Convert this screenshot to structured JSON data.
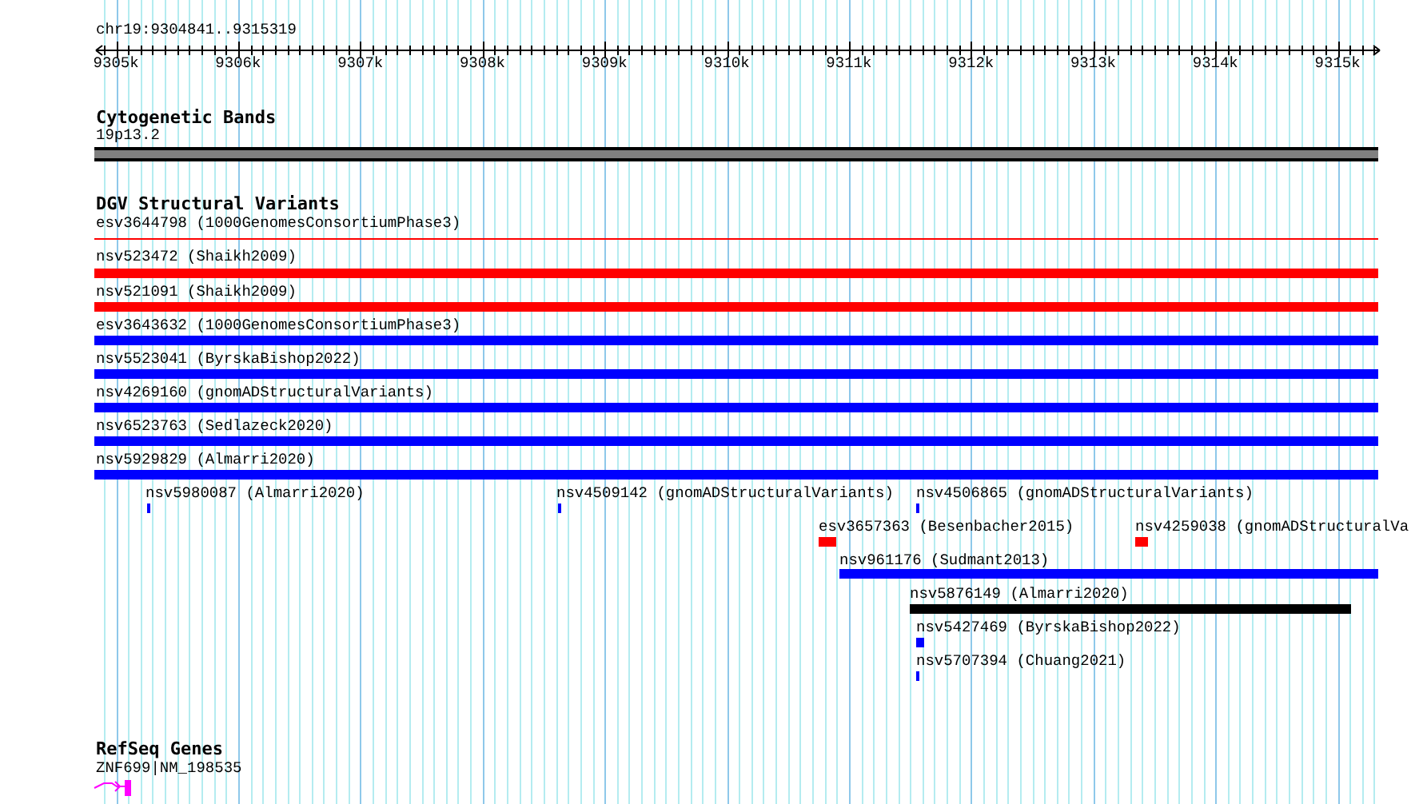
{
  "ruler": {
    "region": "chr19:9304841..9315319",
    "ticks": [
      "9305k",
      "9306k",
      "9307k",
      "9308k",
      "9309k",
      "9310k",
      "9311k",
      "9312k",
      "9313k",
      "9314k",
      "9315k"
    ]
  },
  "tracks": [
    {
      "title": "Cytogenetic Bands",
      "kind": "cytoband",
      "features": [
        {
          "label": "19p13.2",
          "color": "#808080"
        }
      ]
    },
    {
      "title": "DGV Structural Variants",
      "kind": "variants",
      "features": [
        {
          "label": "esv3644798 (1000GenomesConsortiumPhase3)",
          "kind": "line",
          "color": "#ff0000"
        },
        {
          "label": "nsv523472 (Shaikh2009)",
          "kind": "bar",
          "color": "#ff0000"
        },
        {
          "label": "nsv521091 (Shaikh2009)",
          "kind": "bar",
          "color": "#ff0000"
        },
        {
          "label": "esv3643632 (1000GenomesConsortiumPhase3)",
          "kind": "bar",
          "color": "#0000ff"
        },
        {
          "label": "nsv5523041 (ByrskaBishop2022)",
          "kind": "bar",
          "color": "#0000ff"
        },
        {
          "label": "nsv4269160 (gnomADStructuralVariants)",
          "kind": "bar",
          "color": "#0000ff"
        },
        {
          "label": "nsv6523763 (Sedlazeck2020)",
          "kind": "bar",
          "color": "#0000ff"
        },
        {
          "label": "nsv5929829 (Almarri2020)",
          "kind": "bar",
          "color": "#0000ff"
        },
        {
          "label": "nsv5980087 (Almarri2020)",
          "kind": "bar",
          "color": "#0000ff"
        },
        {
          "label": "nsv4509142 (gnomADStructuralVariants)",
          "kind": "bar",
          "color": "#0000ff"
        },
        {
          "label": "nsv4506865 (gnomADStructuralVariants)",
          "kind": "bar",
          "color": "#0000ff"
        },
        {
          "label": "esv3657363 (Besenbacher2015)",
          "kind": "bar",
          "color": "#ff0000"
        },
        {
          "label": "nsv4259038 (gnomADStructuralVa",
          "kind": "bar",
          "color": "#ff0000"
        },
        {
          "label": "nsv961176 (Sudmant2013)",
          "kind": "bar",
          "color": "#0000ff"
        },
        {
          "label": "nsv5876149 (Almarri2020)",
          "kind": "bar",
          "color": "#000000"
        },
        {
          "label": "nsv5427469 (ByrskaBishop2022)",
          "kind": "bar",
          "color": "#0000ff"
        },
        {
          "label": "nsv5707394 (Chuang2021)",
          "kind": "bar",
          "color": "#0000ff"
        }
      ]
    },
    {
      "title": "RefSeq Genes",
      "kind": "genes",
      "features": [
        {
          "label": "ZNF699|NM_198535",
          "color": "#ff00ff"
        }
      ]
    }
  ]
}
